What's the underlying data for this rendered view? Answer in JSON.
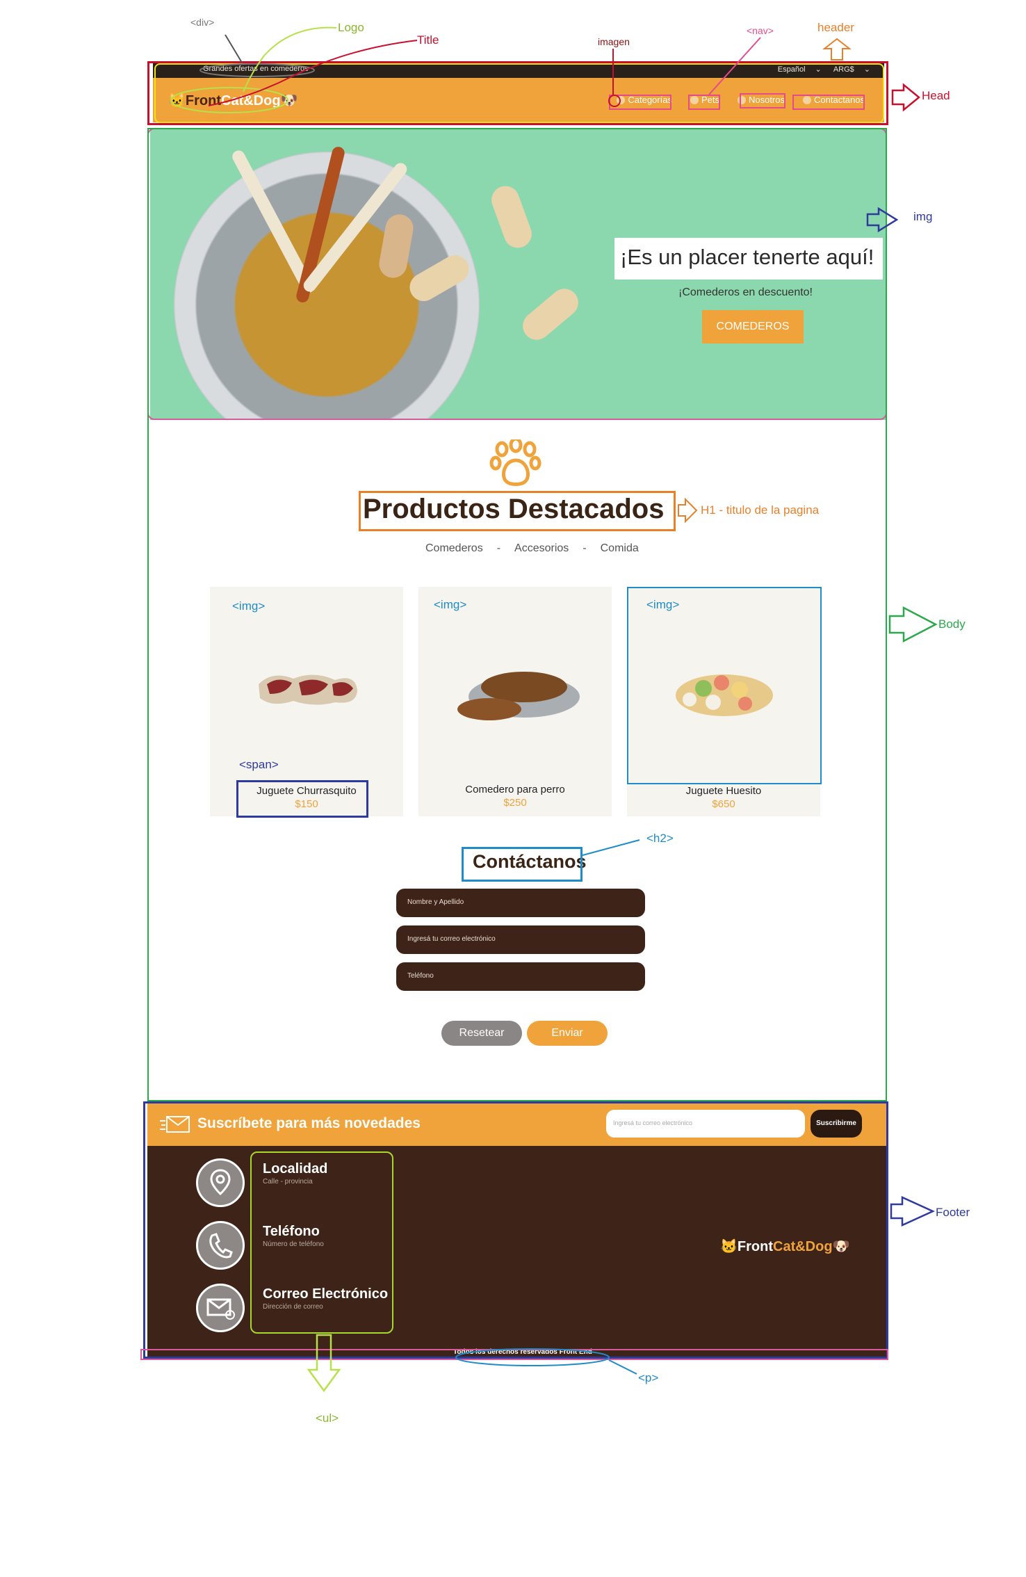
{
  "annotations": {
    "div": "<div>",
    "logo": "Logo",
    "title": "Title",
    "imagen": "imagen",
    "nav": "<nav>",
    "header": "header",
    "head": "Head",
    "img_hero": "img",
    "h1": "H1 - titulo de la pagina",
    "body": "Body",
    "img_card1": "<img>",
    "img_card2": "<img>",
    "img_card3": "<img>",
    "span": "<span>",
    "h2": "<h2>",
    "footer": "Footer",
    "p": "<p>",
    "ul": "<ul>"
  },
  "mockup": {
    "topbar": {
      "promo": "Grandes ofertas en comederos",
      "lang": "Español",
      "currency": "ARG$"
    },
    "logo": {
      "part1": "Front",
      "part2": "Cat&Dog"
    },
    "nav": [
      "Categorías",
      "Pets",
      "Nosotros",
      "Contactanos"
    ],
    "hero": {
      "title": "¡Es un placer tenerte aquí!",
      "subtitle": "¡Comederos en descuento!",
      "button": "COMEDEROS"
    },
    "products_title": "Productos Destacados",
    "filters": [
      "Comederos",
      "-",
      "Accesorios",
      "-",
      "Comida"
    ],
    "products": [
      {
        "name": "Juguete Churrasquito",
        "price": "$150"
      },
      {
        "name": "Comedero para perro",
        "price": "$250"
      },
      {
        "name": "Juguete Huesito",
        "price": "$650"
      }
    ],
    "contact_title": "Contáctanos",
    "fields": [
      "Nombre y Apellido",
      "Ingresá tu correo electrónico",
      "Teléfono"
    ],
    "reset": "Resetear",
    "send": "Enviar",
    "subscribe": {
      "text": "Suscríbete para más novedades",
      "placeholder": "Ingresá tu correo electrónico",
      "button": "Suscribirme"
    },
    "contact_info": [
      {
        "title": "Localidad",
        "sub": "Calle - provincia"
      },
      {
        "title": "Teléfono",
        "sub": "Número de teléfono"
      },
      {
        "title": "Correo Electrónico",
        "sub": "Dirección de correo"
      }
    ],
    "footer_logo": {
      "part1": "Front",
      "part2": "Cat&Dog"
    },
    "copyright": "Todos los derechos reservados Front End"
  },
  "colors": {
    "orange": "#f0a33a",
    "brown": "#3e2418",
    "hero_green": "#8bd8ae",
    "ann_red": "#c8102e",
    "ann_green": "#2aa84a",
    "ann_navy": "#2e3a9e",
    "ann_orange": "#e8802a",
    "ann_cyan": "#1e8cc8",
    "ann_pink": "#d85a9a",
    "ann_lime": "#a8d82a"
  }
}
